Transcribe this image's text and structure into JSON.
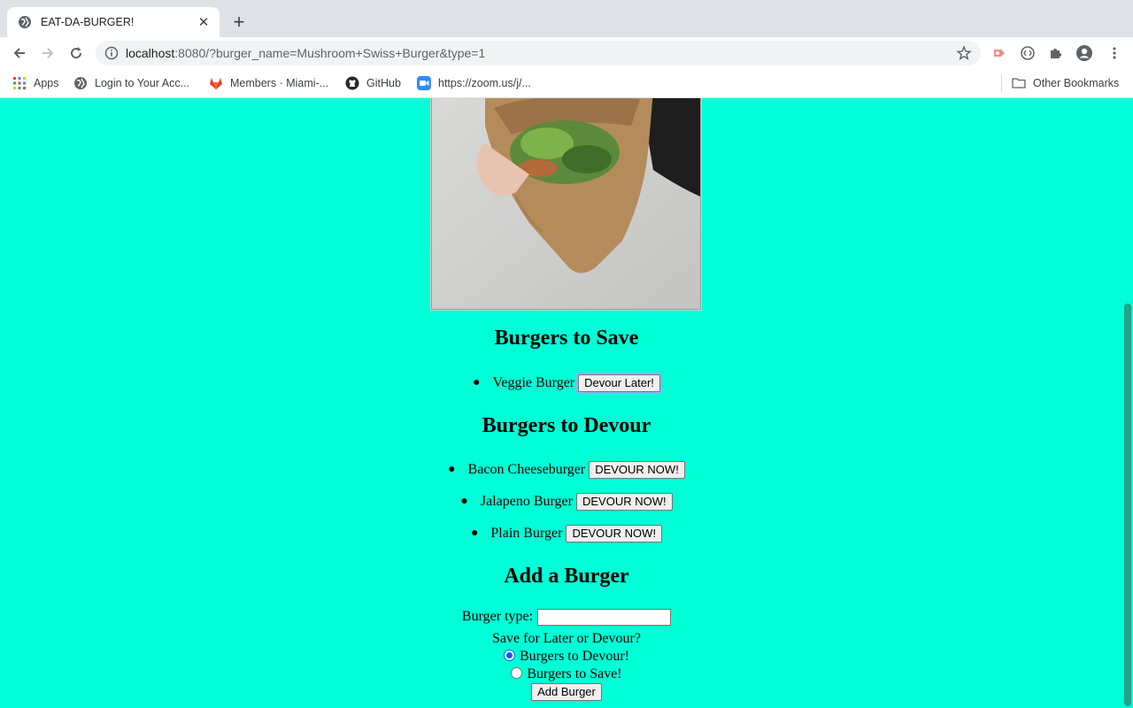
{
  "browser": {
    "tab_title": "EAT-DA-BURGER!",
    "url_host": "localhost",
    "url_rest": ":8080/?burger_name=Mushroom+Swiss+Burger&type=1"
  },
  "bookmarks": {
    "apps": "Apps",
    "items": [
      "Login to Your Acc...",
      "Members · Miami-...",
      "GitHub",
      "https://zoom.us/j/..."
    ],
    "other": "Other Bookmarks"
  },
  "page": {
    "save_heading": "Burgers to Save",
    "save_list": [
      {
        "name": "Veggie Burger",
        "button": "Devour Later!"
      }
    ],
    "devour_heading": "Burgers to Devour",
    "devour_list": [
      {
        "name": "Bacon Cheeseburger",
        "button": "DEVOUR NOW!"
      },
      {
        "name": "Jalapeno Burger",
        "button": "DEVOUR NOW!"
      },
      {
        "name": "Plain Burger",
        "button": "DEVOUR NOW!"
      }
    ],
    "add_heading": "Add a Burger",
    "burger_type_label": "Burger type:",
    "burger_type_value": "",
    "choice_prompt": "Save for Later or Devour?",
    "radio_devour": "Burgers to Devour!",
    "radio_save": "Burgers to Save!",
    "add_button": "Add Burger"
  },
  "colors": {
    "page_background": "#00ffd6",
    "radio_accent": "#0060df"
  }
}
